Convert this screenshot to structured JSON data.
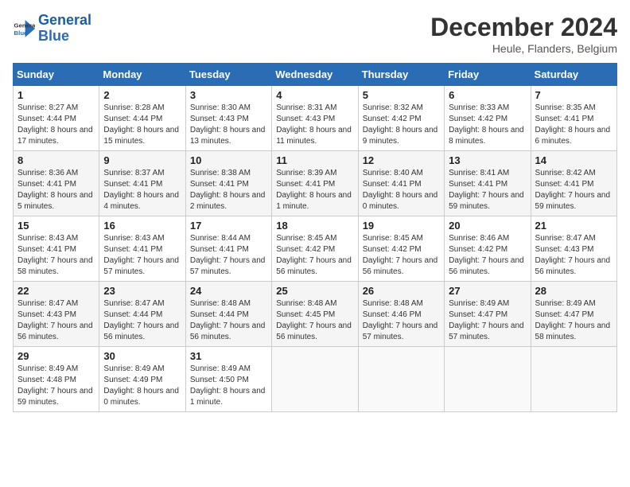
{
  "header": {
    "logo_line1": "General",
    "logo_line2": "Blue",
    "title": "December 2024",
    "subtitle": "Heule, Flanders, Belgium"
  },
  "columns": [
    "Sunday",
    "Monday",
    "Tuesday",
    "Wednesday",
    "Thursday",
    "Friday",
    "Saturday"
  ],
  "weeks": [
    [
      {
        "day": "1",
        "sunrise": "Sunrise: 8:27 AM",
        "sunset": "Sunset: 4:44 PM",
        "daylight": "Daylight: 8 hours and 17 minutes."
      },
      {
        "day": "2",
        "sunrise": "Sunrise: 8:28 AM",
        "sunset": "Sunset: 4:44 PM",
        "daylight": "Daylight: 8 hours and 15 minutes."
      },
      {
        "day": "3",
        "sunrise": "Sunrise: 8:30 AM",
        "sunset": "Sunset: 4:43 PM",
        "daylight": "Daylight: 8 hours and 13 minutes."
      },
      {
        "day": "4",
        "sunrise": "Sunrise: 8:31 AM",
        "sunset": "Sunset: 4:43 PM",
        "daylight": "Daylight: 8 hours and 11 minutes."
      },
      {
        "day": "5",
        "sunrise": "Sunrise: 8:32 AM",
        "sunset": "Sunset: 4:42 PM",
        "daylight": "Daylight: 8 hours and 9 minutes."
      },
      {
        "day": "6",
        "sunrise": "Sunrise: 8:33 AM",
        "sunset": "Sunset: 4:42 PM",
        "daylight": "Daylight: 8 hours and 8 minutes."
      },
      {
        "day": "7",
        "sunrise": "Sunrise: 8:35 AM",
        "sunset": "Sunset: 4:41 PM",
        "daylight": "Daylight: 8 hours and 6 minutes."
      }
    ],
    [
      {
        "day": "8",
        "sunrise": "Sunrise: 8:36 AM",
        "sunset": "Sunset: 4:41 PM",
        "daylight": "Daylight: 8 hours and 5 minutes."
      },
      {
        "day": "9",
        "sunrise": "Sunrise: 8:37 AM",
        "sunset": "Sunset: 4:41 PM",
        "daylight": "Daylight: 8 hours and 4 minutes."
      },
      {
        "day": "10",
        "sunrise": "Sunrise: 8:38 AM",
        "sunset": "Sunset: 4:41 PM",
        "daylight": "Daylight: 8 hours and 2 minutes."
      },
      {
        "day": "11",
        "sunrise": "Sunrise: 8:39 AM",
        "sunset": "Sunset: 4:41 PM",
        "daylight": "Daylight: 8 hours and 1 minute."
      },
      {
        "day": "12",
        "sunrise": "Sunrise: 8:40 AM",
        "sunset": "Sunset: 4:41 PM",
        "daylight": "Daylight: 8 hours and 0 minutes."
      },
      {
        "day": "13",
        "sunrise": "Sunrise: 8:41 AM",
        "sunset": "Sunset: 4:41 PM",
        "daylight": "Daylight: 7 hours and 59 minutes."
      },
      {
        "day": "14",
        "sunrise": "Sunrise: 8:42 AM",
        "sunset": "Sunset: 4:41 PM",
        "daylight": "Daylight: 7 hours and 59 minutes."
      }
    ],
    [
      {
        "day": "15",
        "sunrise": "Sunrise: 8:43 AM",
        "sunset": "Sunset: 4:41 PM",
        "daylight": "Daylight: 7 hours and 58 minutes."
      },
      {
        "day": "16",
        "sunrise": "Sunrise: 8:43 AM",
        "sunset": "Sunset: 4:41 PM",
        "daylight": "Daylight: 7 hours and 57 minutes."
      },
      {
        "day": "17",
        "sunrise": "Sunrise: 8:44 AM",
        "sunset": "Sunset: 4:41 PM",
        "daylight": "Daylight: 7 hours and 57 minutes."
      },
      {
        "day": "18",
        "sunrise": "Sunrise: 8:45 AM",
        "sunset": "Sunset: 4:42 PM",
        "daylight": "Daylight: 7 hours and 56 minutes."
      },
      {
        "day": "19",
        "sunrise": "Sunrise: 8:45 AM",
        "sunset": "Sunset: 4:42 PM",
        "daylight": "Daylight: 7 hours and 56 minutes."
      },
      {
        "day": "20",
        "sunrise": "Sunrise: 8:46 AM",
        "sunset": "Sunset: 4:42 PM",
        "daylight": "Daylight: 7 hours and 56 minutes."
      },
      {
        "day": "21",
        "sunrise": "Sunrise: 8:47 AM",
        "sunset": "Sunset: 4:43 PM",
        "daylight": "Daylight: 7 hours and 56 minutes."
      }
    ],
    [
      {
        "day": "22",
        "sunrise": "Sunrise: 8:47 AM",
        "sunset": "Sunset: 4:43 PM",
        "daylight": "Daylight: 7 hours and 56 minutes."
      },
      {
        "day": "23",
        "sunrise": "Sunrise: 8:47 AM",
        "sunset": "Sunset: 4:44 PM",
        "daylight": "Daylight: 7 hours and 56 minutes."
      },
      {
        "day": "24",
        "sunrise": "Sunrise: 8:48 AM",
        "sunset": "Sunset: 4:44 PM",
        "daylight": "Daylight: 7 hours and 56 minutes."
      },
      {
        "day": "25",
        "sunrise": "Sunrise: 8:48 AM",
        "sunset": "Sunset: 4:45 PM",
        "daylight": "Daylight: 7 hours and 56 minutes."
      },
      {
        "day": "26",
        "sunrise": "Sunrise: 8:48 AM",
        "sunset": "Sunset: 4:46 PM",
        "daylight": "Daylight: 7 hours and 57 minutes."
      },
      {
        "day": "27",
        "sunrise": "Sunrise: 8:49 AM",
        "sunset": "Sunset: 4:47 PM",
        "daylight": "Daylight: 7 hours and 57 minutes."
      },
      {
        "day": "28",
        "sunrise": "Sunrise: 8:49 AM",
        "sunset": "Sunset: 4:47 PM",
        "daylight": "Daylight: 7 hours and 58 minutes."
      }
    ],
    [
      {
        "day": "29",
        "sunrise": "Sunrise: 8:49 AM",
        "sunset": "Sunset: 4:48 PM",
        "daylight": "Daylight: 7 hours and 59 minutes."
      },
      {
        "day": "30",
        "sunrise": "Sunrise: 8:49 AM",
        "sunset": "Sunset: 4:49 PM",
        "daylight": "Daylight: 8 hours and 0 minutes."
      },
      {
        "day": "31",
        "sunrise": "Sunrise: 8:49 AM",
        "sunset": "Sunset: 4:50 PM",
        "daylight": "Daylight: 8 hours and 1 minute."
      },
      null,
      null,
      null,
      null
    ]
  ]
}
